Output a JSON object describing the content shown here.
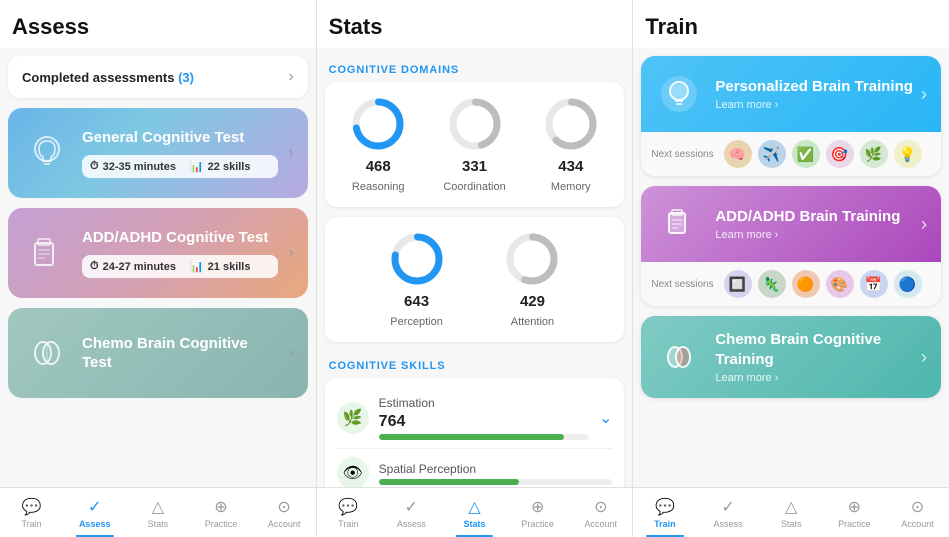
{
  "panels": {
    "assess": {
      "title": "Assess",
      "completed_bar": {
        "text": "Completed assessments",
        "count": "(3)",
        "chevron": "›"
      },
      "tests": [
        {
          "title": "General Cognitive Test",
          "time": "32-35 minutes",
          "skills": "22 skills",
          "color": "blue"
        },
        {
          "title": "ADD/ADHD Cognitive Test",
          "time": "24-27 minutes",
          "skills": "21 skills",
          "color": "purple"
        },
        {
          "title": "Chemo Brain Cognitive Test",
          "time": "",
          "skills": "",
          "color": "teal"
        }
      ]
    },
    "stats": {
      "title": "Stats",
      "cognitive_domains_label": "COGNITIVE DOMAINS",
      "domains": [
        {
          "value": "468",
          "label": "Reasoning",
          "pct": 0.72
        },
        {
          "value": "331",
          "label": "Coordination",
          "pct": 0.45
        },
        {
          "value": "434",
          "label": "Memory",
          "pct": 0.62
        }
      ],
      "domains2": [
        {
          "value": "643",
          "label": "Perception",
          "pct": 0.78
        },
        {
          "value": "429",
          "label": "Attention",
          "pct": 0.55
        }
      ],
      "cognitive_skills_label": "COGNITIVE SKILLS",
      "skills": [
        {
          "name": "Estimation",
          "value": "764",
          "pct": 0.88,
          "color": "#4caf50"
        },
        {
          "name": "Spatial Perception",
          "value": "",
          "pct": 0.6,
          "color": "#4caf50"
        }
      ]
    },
    "train": {
      "title": "Train",
      "programs": [
        {
          "title": "Personalized Brain Training",
          "link": "Learn more >",
          "color": "blue",
          "sessions_label": "Next sessions",
          "sessions": [
            "🧠",
            "✈️",
            "✅",
            "🎯",
            "🌿",
            "💡"
          ]
        },
        {
          "title": "ADD/ADHD Brain Training",
          "link": "Learn more >",
          "color": "purple",
          "sessions_label": "Next sessions",
          "sessions": [
            "🔲",
            "🦎",
            "🟠",
            "🎨",
            "📅",
            "🔵"
          ]
        },
        {
          "title": "Chemo Brain Cognitive Training",
          "link": "Learn more >",
          "color": "teal",
          "sessions_label": "",
          "sessions": []
        }
      ]
    }
  },
  "nav": {
    "sections": [
      {
        "items": [
          {
            "label": "Train",
            "icon": "💬",
            "active": false
          },
          {
            "label": "Assess",
            "icon": "✓",
            "active": true
          },
          {
            "label": "Stats",
            "icon": "△",
            "active": false
          },
          {
            "label": "Practice",
            "icon": "⊕",
            "active": false
          },
          {
            "label": "Account",
            "icon": "⊙",
            "active": false
          }
        ]
      },
      {
        "items": [
          {
            "label": "Train",
            "icon": "💬",
            "active": false
          },
          {
            "label": "Assess",
            "icon": "✓",
            "active": false
          },
          {
            "label": "Stats",
            "icon": "△",
            "active": true
          },
          {
            "label": "Practice",
            "icon": "⊕",
            "active": false
          },
          {
            "label": "Account",
            "icon": "⊙",
            "active": false
          }
        ]
      },
      {
        "items": [
          {
            "label": "Train",
            "icon": "💬",
            "active": true
          },
          {
            "label": "Assess",
            "icon": "✓",
            "active": false
          },
          {
            "label": "Stats",
            "icon": "△",
            "active": false
          },
          {
            "label": "Practice",
            "icon": "⊕",
            "active": false
          },
          {
            "label": "Account",
            "icon": "⊙",
            "active": false
          }
        ]
      }
    ]
  }
}
